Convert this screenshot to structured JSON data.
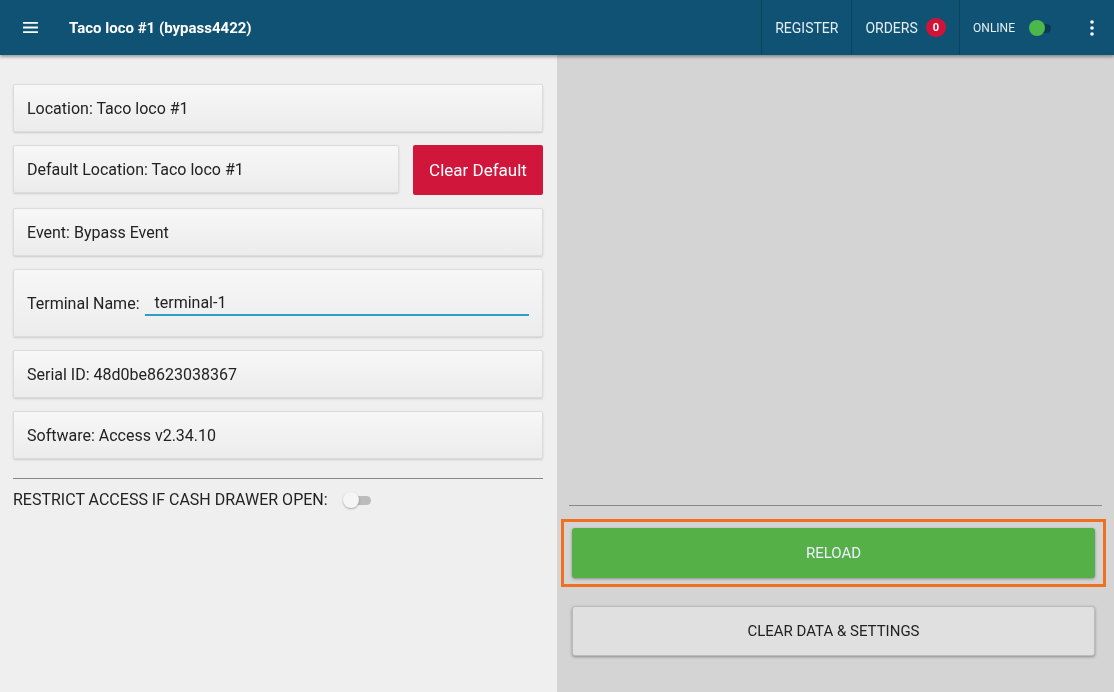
{
  "app_bar": {
    "title": "Taco loco #1 (bypass4422)",
    "actions": [
      {
        "kind": "link",
        "label": "REGISTER"
      },
      {
        "kind": "badge",
        "label": "ORDERS",
        "badge": "0"
      },
      {
        "kind": "toggle",
        "label": "ONLINE",
        "on": true
      }
    ]
  },
  "settings": [
    {
      "kind": "info",
      "text": "Location: Taco loco #1"
    },
    {
      "kind": "info_button",
      "text": "Default Location: Taco loco #1",
      "button": "Clear Default"
    },
    {
      "kind": "info",
      "text": "Event: Bypass Event"
    },
    {
      "kind": "field",
      "label": "Terminal Name:",
      "value": "terminal-1",
      "focused": true
    },
    {
      "kind": "info",
      "text": "Serial ID: 48d0be8623038367"
    },
    {
      "kind": "info",
      "text": "Software: Access v2.34.10"
    }
  ],
  "restrict": {
    "label": "RESTRICT ACCESS IF CASH DRAWER OPEN:",
    "on": false
  },
  "buttons": [
    {
      "kind": "primary",
      "label": "RELOAD",
      "highlighted": true
    },
    {
      "kind": "secondary",
      "label": "CLEAR DATA & SETTINGS",
      "highlighted": false
    }
  ]
}
